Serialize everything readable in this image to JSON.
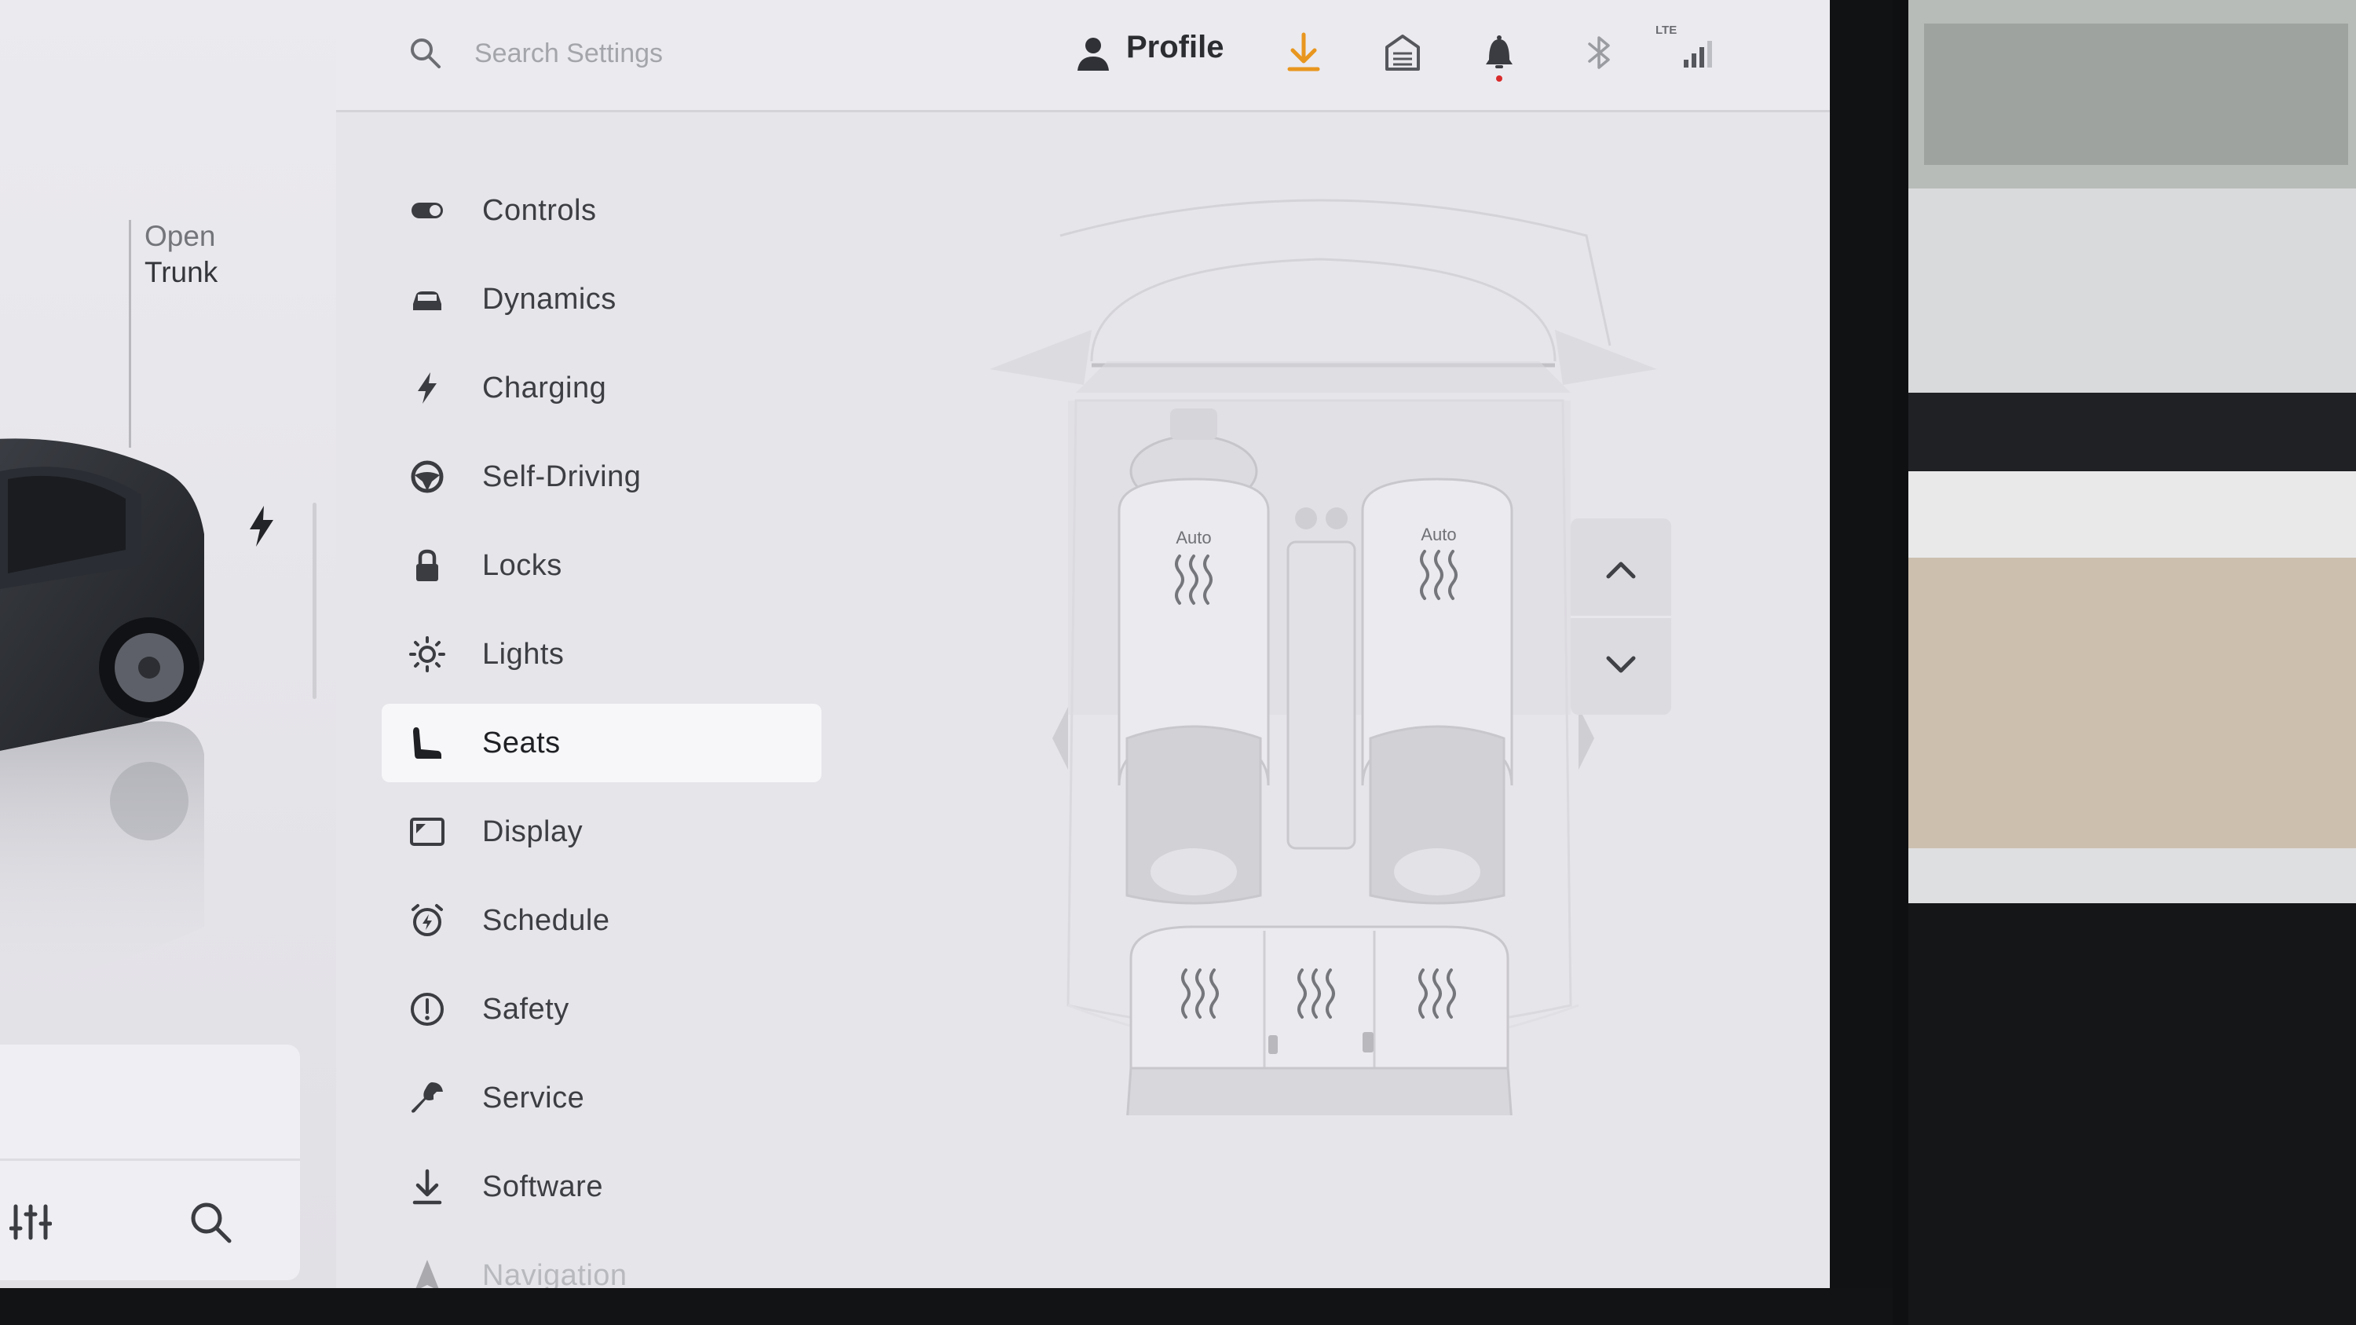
{
  "left_panel": {
    "trunk_open_label": "Open",
    "trunk_label": "Trunk"
  },
  "top_bar": {
    "search_placeholder": "Search Settings",
    "profile_label": "Profile",
    "signal_type": "LTE",
    "accent_color": "#e8961e",
    "notification_dot_color": "#d92b2b"
  },
  "nav": {
    "items": [
      {
        "label": "Controls",
        "icon": "toggle-icon"
      },
      {
        "label": "Dynamics",
        "icon": "car-icon"
      },
      {
        "label": "Charging",
        "icon": "lightning-icon"
      },
      {
        "label": "Self-Driving",
        "icon": "steering-wheel-icon"
      },
      {
        "label": "Locks",
        "icon": "lock-icon"
      },
      {
        "label": "Lights",
        "icon": "sun-icon"
      },
      {
        "label": "Seats",
        "icon": "seat-icon",
        "active": true
      },
      {
        "label": "Display",
        "icon": "display-icon"
      },
      {
        "label": "Schedule",
        "icon": "alarm-clock-icon"
      },
      {
        "label": "Safety",
        "icon": "alert-circle-icon"
      },
      {
        "label": "Service",
        "icon": "wrench-icon"
      },
      {
        "label": "Software",
        "icon": "download-icon"
      },
      {
        "label": "Navigation",
        "icon": "navigation-arrow-icon"
      }
    ]
  },
  "seats": {
    "driver_label": "Auto",
    "passenger_label": "Auto"
  }
}
